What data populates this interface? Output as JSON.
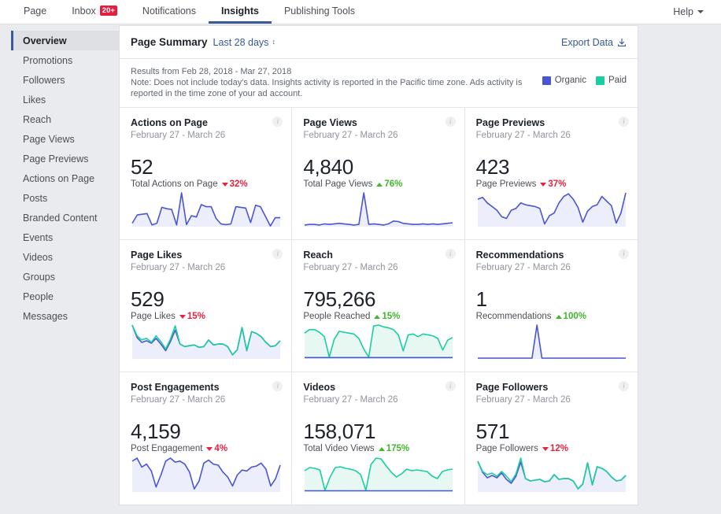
{
  "topnav": {
    "items": [
      {
        "label": "Page",
        "active": false,
        "badge": null
      },
      {
        "label": "Inbox",
        "active": false,
        "badge": "20+"
      },
      {
        "label": "Notifications",
        "active": false,
        "badge": null
      },
      {
        "label": "Insights",
        "active": true,
        "badge": null
      },
      {
        "label": "Publishing Tools",
        "active": false,
        "badge": null
      }
    ],
    "help_label": "Help"
  },
  "sidebar": {
    "items": [
      {
        "label": "Overview",
        "active": true
      },
      {
        "label": "Promotions",
        "active": false
      },
      {
        "label": "Followers",
        "active": false
      },
      {
        "label": "Likes",
        "active": false
      },
      {
        "label": "Reach",
        "active": false
      },
      {
        "label": "Page Views",
        "active": false
      },
      {
        "label": "Page Previews",
        "active": false
      },
      {
        "label": "Actions on Page",
        "active": false
      },
      {
        "label": "Posts",
        "active": false
      },
      {
        "label": "Branded Content",
        "active": false
      },
      {
        "label": "Events",
        "active": false
      },
      {
        "label": "Videos",
        "active": false
      },
      {
        "label": "Groups",
        "active": false
      },
      {
        "label": "People",
        "active": false
      },
      {
        "label": "Messages",
        "active": false
      }
    ]
  },
  "summary": {
    "title": "Page Summary",
    "range_label": "Last 28 days",
    "export_label": "Export Data",
    "results_line": "Results from Feb 28, 2018 - Mar 27, 2018",
    "note_line": "Note: Does not include today's data. Insights activity is reported in the Pacific time zone. Ads activity is reported in the time zone of your ad account.",
    "legend": [
      {
        "label": "Organic",
        "color": "#4a55d4"
      },
      {
        "label": "Paid",
        "color": "#19cfa0"
      }
    ]
  },
  "colors": {
    "organic": "#4a55d4",
    "organic_fill": "#eceefb",
    "paid": "#19cfa0",
    "paid_fill": "#e7f8f3",
    "up": "#42b72a",
    "down": "#e9213e",
    "accent": "#365899"
  },
  "cards": [
    {
      "title": "Actions on Page",
      "date_range": "February 27 - March 26",
      "value": "52",
      "metric_label": "Total Actions on Page",
      "delta": "32%",
      "delta_dir": "down",
      "info": "i",
      "chart_data": {
        "type": "area",
        "title": "Actions on Page",
        "xlabel": "",
        "ylabel": "",
        "grid": false,
        "legend": "none",
        "series": [
          {
            "name": "Organic",
            "color": "#4a55d4",
            "filled": true,
            "values": [
              10,
              34,
              36,
              38,
              5,
              10,
              56,
              52,
              50,
              5,
              98,
              6,
              32,
              28,
              64,
              58,
              58,
              24,
              8,
              6,
              8,
              58,
              56,
              54,
              12,
              62,
              58,
              30,
              2,
              26,
              26
            ]
          }
        ]
      }
    },
    {
      "title": "Page Views",
      "date_range": "February 27 - March 26",
      "value": "4,840",
      "metric_label": "Total Page Views",
      "delta": "76%",
      "delta_dir": "up",
      "info": "i",
      "chart_data": {
        "type": "area",
        "title": "Page Views",
        "xlabel": "",
        "ylabel": "",
        "grid": false,
        "legend": "none",
        "series": [
          {
            "name": "Organic",
            "color": "#4a55d4",
            "filled": true,
            "values": [
              3,
              4,
              4,
              3,
              5,
              4,
              5,
              6,
              5,
              4,
              3,
              4,
              60,
              4,
              5,
              4,
              3,
              5,
              10,
              9,
              6,
              5,
              4,
              4,
              5,
              4,
              5,
              4,
              5,
              6,
              7
            ]
          }
        ]
      }
    },
    {
      "title": "Page Previews",
      "date_range": "February 27 - March 26",
      "value": "423",
      "metric_label": "Page Previews",
      "delta": "37%",
      "delta_dir": "down",
      "info": "i",
      "chart_data": {
        "type": "area",
        "title": "Page Previews",
        "xlabel": "",
        "ylabel": "",
        "grid": false,
        "legend": "none",
        "series": [
          {
            "name": "Organic",
            "color": "#4a55d4",
            "filled": true,
            "values": [
              60,
              64,
              52,
              44,
              36,
              22,
              18,
              36,
              40,
              52,
              48,
              46,
              44,
              40,
              6,
              24,
              30,
              52,
              66,
              72,
              60,
              42,
              10,
              34,
              44,
              48,
              66,
              56,
              46,
              8,
              30,
              74
            ]
          }
        ]
      }
    },
    {
      "title": "Page Likes",
      "date_range": "February 27 - March 26",
      "value": "529",
      "metric_label": "Page Likes",
      "delta": "15%",
      "delta_dir": "down",
      "info": "i",
      "chart_data": {
        "type": "line",
        "title": "Page Likes",
        "xlabel": "",
        "ylabel": "",
        "grid": false,
        "legend": "none",
        "series": [
          {
            "name": "Organic",
            "color": "#4a55d4",
            "filled": true,
            "values": [
              82,
              52,
              40,
              44,
              38,
              50,
              36,
              20,
              42,
              70,
              36,
              30,
              32,
              34,
              28,
              30,
              46,
              34,
              36,
              36,
              30,
              10,
              22,
              76,
              20,
              66,
              62,
              54,
              40,
              30,
              32,
              44
            ]
          },
          {
            "name": "Paid",
            "color": "#19cfa0",
            "filled": false,
            "values": [
              82,
              56,
              46,
              50,
              40,
              56,
              42,
              24,
              48,
              80,
              36,
              30,
              32,
              34,
              28,
              30,
              46,
              34,
              36,
              36,
              30,
              10,
              22,
              76,
              20,
              66,
              62,
              54,
              40,
              30,
              32,
              44
            ]
          }
        ]
      }
    },
    {
      "title": "Reach",
      "date_range": "February 27 - March 26",
      "value": "795,266",
      "metric_label": "People Reached",
      "delta": "15%",
      "delta_dir": "up",
      "info": "i",
      "chart_data": {
        "type": "area",
        "title": "Reach",
        "xlabel": "",
        "ylabel": "",
        "grid": false,
        "legend": "none",
        "series": [
          {
            "name": "Paid",
            "color": "#19cfa0",
            "filled": true,
            "values": [
              58,
              66,
              66,
              60,
              50,
              4,
              44,
              62,
              60,
              58,
              56,
              46,
              22,
              4,
              74,
              76,
              72,
              70,
              66,
              54,
              18,
              54,
              56,
              50,
              56,
              54,
              52,
              46,
              20,
              42,
              48
            ]
          },
          {
            "name": "Organic",
            "color": "#4a55d4",
            "filled": false,
            "values": [
              3,
              3,
              3,
              3,
              3,
              3,
              3,
              3,
              3,
              3,
              3,
              3,
              3,
              3,
              3,
              3,
              3,
              3,
              3,
              3,
              3,
              3,
              3,
              3,
              3,
              3,
              3,
              3,
              3,
              3,
              3
            ]
          }
        ]
      }
    },
    {
      "title": "Recommendations",
      "date_range": "February 27 - March 26",
      "value": "1",
      "metric_label": "Recommendations",
      "delta": "100%",
      "delta_dir": "up",
      "info": "i",
      "chart_data": {
        "type": "area",
        "title": "Recommendations",
        "xlabel": "",
        "ylabel": "",
        "grid": false,
        "legend": "none",
        "series": [
          {
            "name": "Organic",
            "color": "#4a55d4",
            "filled": true,
            "values": [
              2,
              2,
              2,
              2,
              2,
              2,
              2,
              2,
              2,
              2,
              2,
              2,
              90,
              2,
              2,
              2,
              2,
              2,
              2,
              2,
              2,
              2,
              2,
              2,
              2,
              2,
              2,
              2,
              2,
              2,
              2
            ]
          }
        ]
      }
    },
    {
      "title": "Post Engagements",
      "date_range": "February 27 - March 26",
      "value": "4,159",
      "metric_label": "Post Engagement",
      "delta": "4%",
      "delta_dir": "down",
      "info": "i",
      "chart_data": {
        "type": "area",
        "title": "Post Engagements",
        "xlabel": "",
        "ylabel": "",
        "grid": false,
        "legend": "none",
        "series": [
          {
            "name": "Organic",
            "color": "#4a55d4",
            "filled": true,
            "values": [
              62,
              68,
              50,
              56,
              42,
              10,
              34,
              62,
              68,
              60,
              62,
              56,
              40,
              6,
              22,
              58,
              64,
              56,
              54,
              40,
              30,
              12,
              34,
              44,
              42,
              50,
              52,
              58,
              46,
              12,
              26,
              54
            ]
          }
        ]
      }
    },
    {
      "title": "Videos",
      "date_range": "February 27 - March 26",
      "value": "158,071",
      "metric_label": "Total Video Views",
      "delta": "175%",
      "delta_dir": "up",
      "info": "i",
      "chart_data": {
        "type": "area",
        "title": "Videos",
        "xlabel": "",
        "ylabel": "",
        "grid": false,
        "legend": "none",
        "series": [
          {
            "name": "Paid",
            "color": "#19cfa0",
            "filled": true,
            "values": [
              54,
              62,
              60,
              56,
              4,
              38,
              62,
              64,
              60,
              58,
              54,
              44,
              4,
              70,
              86,
              84,
              66,
              50,
              38,
              46,
              58,
              54,
              56,
              54,
              52,
              40,
              34,
              52,
              56,
              58
            ]
          },
          {
            "name": "Organic",
            "color": "#4a55d4",
            "filled": false,
            "values": [
              3,
              3,
              3,
              3,
              3,
              3,
              3,
              3,
              3,
              3,
              3,
              3,
              3,
              3,
              3,
              3,
              3,
              3,
              3,
              3,
              3,
              3,
              3,
              3,
              3,
              3,
              3,
              3,
              3,
              3
            ]
          }
        ]
      }
    },
    {
      "title": "Page Followers",
      "date_range": "February 27 - March 26",
      "value": "571",
      "metric_label": "Page Followers",
      "delta": "12%",
      "delta_dir": "down",
      "info": "i",
      "chart_data": {
        "type": "line",
        "title": "Page Followers",
        "xlabel": "",
        "ylabel": "",
        "grid": false,
        "legend": "none",
        "series": [
          {
            "name": "Organic",
            "color": "#4a55d4",
            "filled": true,
            "values": [
              78,
              50,
              36,
              42,
              36,
              48,
              32,
              22,
              40,
              76,
              34,
              28,
              30,
              32,
              26,
              28,
              44,
              32,
              34,
              34,
              28,
              8,
              20,
              74,
              18,
              64,
              60,
              52,
              38,
              28,
              30,
              42
            ]
          },
          {
            "name": "Paid",
            "color": "#19cfa0",
            "filled": false,
            "values": [
              78,
              52,
              44,
              48,
              40,
              52,
              40,
              26,
              46,
              86,
              34,
              28,
              30,
              32,
              26,
              28,
              44,
              32,
              34,
              34,
              28,
              8,
              20,
              74,
              18,
              64,
              60,
              52,
              38,
              28,
              30,
              42
            ]
          }
        ]
      }
    }
  ]
}
